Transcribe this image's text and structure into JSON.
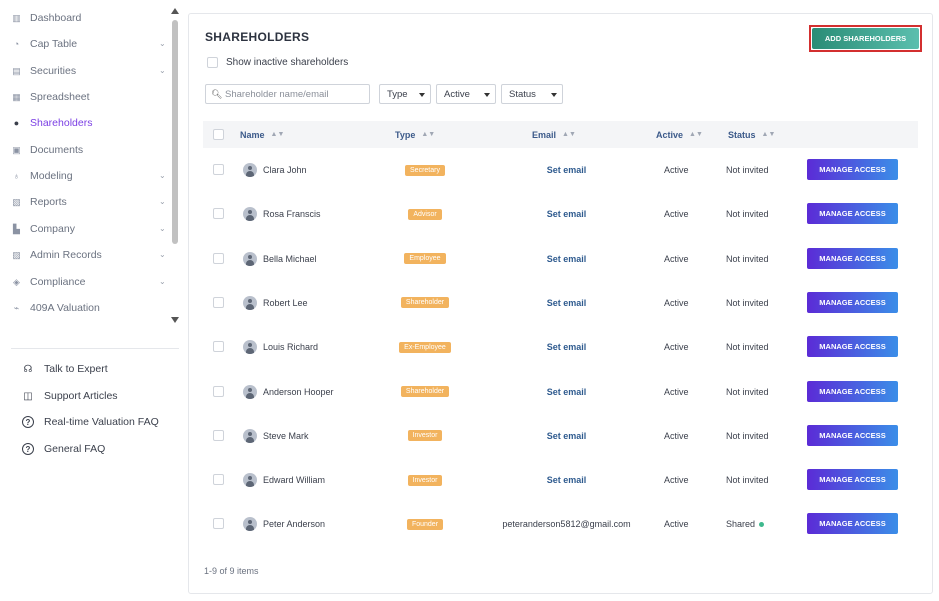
{
  "sidebar": {
    "items": [
      {
        "label": "Dashboard",
        "icon": "dashboard-icon",
        "glyph": "▥",
        "chevron": false,
        "active": false
      },
      {
        "label": "Cap Table",
        "icon": "pie-chart-icon",
        "glyph": "◔",
        "chevron": true,
        "active": false
      },
      {
        "label": "Securities",
        "icon": "clipboard-icon",
        "glyph": "▤",
        "chevron": true,
        "active": false
      },
      {
        "label": "Spreadsheet",
        "icon": "spreadsheet-icon",
        "glyph": "▦",
        "chevron": false,
        "active": false
      },
      {
        "label": "Shareholders",
        "icon": "user-icon",
        "glyph": "●",
        "chevron": false,
        "active": true
      },
      {
        "label": "Documents",
        "icon": "document-icon",
        "glyph": "▣",
        "chevron": false,
        "active": false
      },
      {
        "label": "Modeling",
        "icon": "bulb-icon",
        "glyph": "♁",
        "chevron": true,
        "active": false
      },
      {
        "label": "Reports",
        "icon": "report-icon",
        "glyph": "▧",
        "chevron": true,
        "active": false
      },
      {
        "label": "Company",
        "icon": "building-icon",
        "glyph": "▙",
        "chevron": true,
        "active": false
      },
      {
        "label": "Admin Records",
        "icon": "records-icon",
        "glyph": "▨",
        "chevron": true,
        "active": false
      },
      {
        "label": "Compliance",
        "icon": "shield-icon",
        "glyph": "◈",
        "chevron": true,
        "active": false
      },
      {
        "label": "409A Valuation",
        "icon": "valuation-icon",
        "glyph": "⌁",
        "chevron": false,
        "active": false
      }
    ],
    "help": [
      {
        "label": "Talk to Expert",
        "icon": "headset-icon",
        "glyph": "☊"
      },
      {
        "label": "Support Articles",
        "icon": "book-icon",
        "glyph": "◫"
      },
      {
        "label": "Real-time Valuation FAQ",
        "icon": "question-icon",
        "glyph": "?"
      },
      {
        "label": "General FAQ",
        "icon": "question-icon",
        "glyph": "?"
      }
    ]
  },
  "main": {
    "title": "SHAREHOLDERS",
    "add_button": "ADD SHAREHOLDERS",
    "show_inactive": "Show inactive shareholders",
    "search_placeholder": "Shareholder name/email",
    "filters": {
      "type": "Type",
      "active": "Active",
      "status": "Status"
    },
    "columns": {
      "name": "Name",
      "type": "Type",
      "email": "Email",
      "active": "Active",
      "status": "Status"
    },
    "manage_label": "MANAGE ACCESS",
    "footer": "1-9 of 9 items",
    "colors": {
      "accent": "#7b3fe4",
      "badge": "#f2b35e",
      "add_button": "#2a8c76",
      "manage_start": "#5b2bd6",
      "manage_end": "#3b8ee8",
      "shared_dot": "#3fb98e"
    }
  },
  "rows": [
    {
      "name": "Clara John",
      "type": "Secretary",
      "email": "Set email",
      "email_is_link": true,
      "active": "Active",
      "status": "Not invited",
      "shared": false
    },
    {
      "name": "Rosa Franscis",
      "type": "Advisor",
      "email": "Set email",
      "email_is_link": true,
      "active": "Active",
      "status": "Not invited",
      "shared": false
    },
    {
      "name": "Bella Michael",
      "type": "Employee",
      "email": "Set email",
      "email_is_link": true,
      "active": "Active",
      "status": "Not invited",
      "shared": false
    },
    {
      "name": "Robert Lee",
      "type": "Shareholder",
      "email": "Set email",
      "email_is_link": true,
      "active": "Active",
      "status": "Not invited",
      "shared": false
    },
    {
      "name": "Louis Richard",
      "type": "Ex-Employee",
      "email": "Set email",
      "email_is_link": true,
      "active": "Active",
      "status": "Not invited",
      "shared": false
    },
    {
      "name": "Anderson Hooper",
      "type": "Shareholder",
      "email": "Set email",
      "email_is_link": true,
      "active": "Active",
      "status": "Not invited",
      "shared": false
    },
    {
      "name": "Steve Mark",
      "type": "Investor",
      "email": "Set email",
      "email_is_link": true,
      "active": "Active",
      "status": "Not invited",
      "shared": false
    },
    {
      "name": "Edward William",
      "type": "Investor",
      "email": "Set email",
      "email_is_link": true,
      "active": "Active",
      "status": "Not invited",
      "shared": false
    },
    {
      "name": "Peter Anderson",
      "type": "Founder",
      "email": "peteranderson5812@gmail.com",
      "email_is_link": false,
      "active": "Active",
      "status": "Shared",
      "shared": true
    }
  ]
}
